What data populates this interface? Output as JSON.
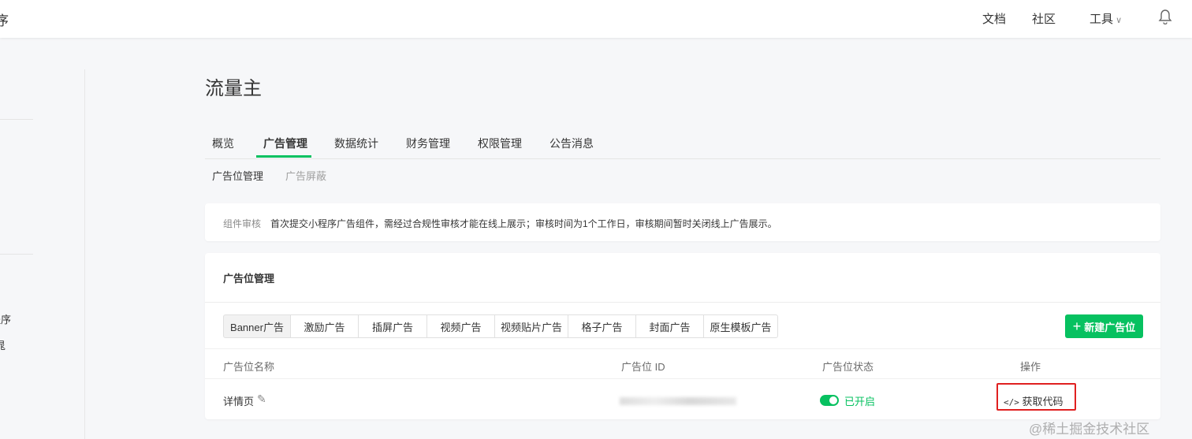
{
  "header": {
    "app_title_fragment": "序",
    "links": [
      "文档",
      "社区",
      "工具"
    ]
  },
  "sidebar": {
    "items": [
      "程序",
      "晁"
    ]
  },
  "page": {
    "title": "流量主"
  },
  "tabs": [
    "概览",
    "广告管理",
    "数据统计",
    "财务管理",
    "权限管理",
    "公告消息"
  ],
  "subtabs": [
    "广告位管理",
    "广告屏蔽"
  ],
  "notice": {
    "label": "组件审核",
    "text": "首次提交小程序广告组件，需经过合规性审核才能在线上展示；审核时间为1个工作日，审核期间暂时关闭线上广告展示。"
  },
  "panel": {
    "title": "广告位管理",
    "ad_types": [
      "Banner广告",
      "激励广告",
      "插屏广告",
      "视频广告",
      "视频贴片广告",
      "格子广告",
      "封面广告",
      "原生模板广告"
    ],
    "new_button": "新建广告位",
    "columns": [
      "广告位名称",
      "广告位 ID",
      "广告位状态",
      "操作"
    ],
    "rows": [
      {
        "name": "详情页",
        "status": "已开启",
        "action": "获取代码"
      }
    ]
  },
  "watermark": "@稀土掘金技术社区",
  "colors": {
    "accent": "#07c160",
    "highlight": "#e02020"
  }
}
